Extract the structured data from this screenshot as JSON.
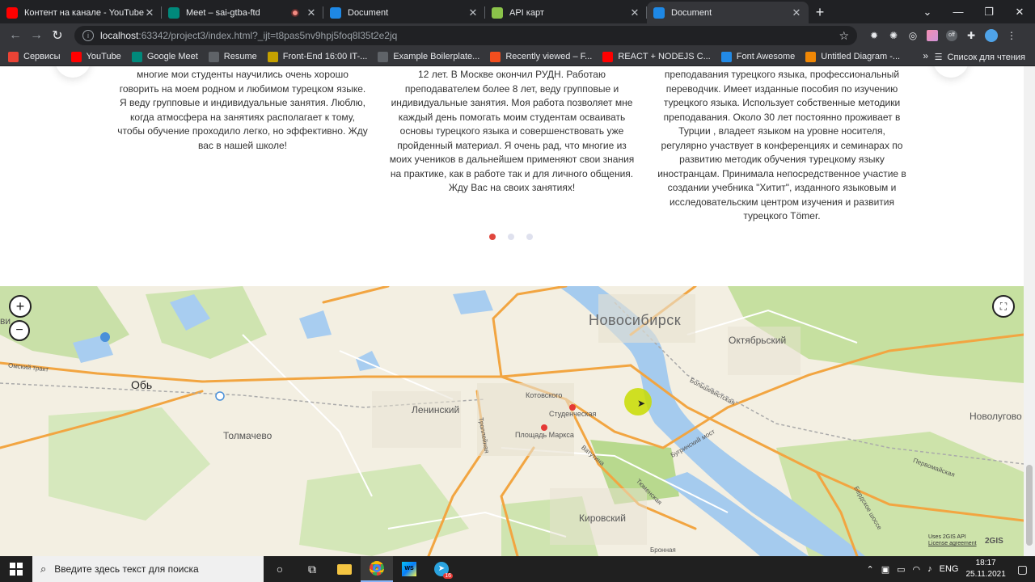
{
  "browser": {
    "tabs": [
      {
        "title": "Контент на канале - YouTube Studio",
        "icon": "youtube-icon",
        "color": "#ff0000",
        "active": false,
        "recording": false
      },
      {
        "title": "Meet – sai-gtba-ftd",
        "icon": "google-meet-icon",
        "color": "#00897b",
        "active": false,
        "recording": true
      },
      {
        "title": "Document",
        "icon": "webstorm-document-icon",
        "color": "#1e88e5",
        "active": false,
        "recording": false
      },
      {
        "title": "API карт",
        "icon": "api-2gis-icon",
        "color": "#8bc34a",
        "active": false,
        "recording": false
      },
      {
        "title": "Document",
        "icon": "webstorm-document-icon",
        "color": "#1e88e5",
        "active": true,
        "recording": false
      }
    ],
    "address": {
      "host": "localhost",
      "path": ":63342/project3/index.html?_ijt=t8pas5nv9hpj5foq8l35t2e2jq"
    },
    "bookmarks": [
      {
        "label": "Сервисы",
        "icon": "apps-grid-icon",
        "color": "#ea4335"
      },
      {
        "label": "YouTube",
        "icon": "youtube-icon",
        "color": "#ff0000"
      },
      {
        "label": "Google Meet",
        "icon": "google-meet-icon",
        "color": "#00897b"
      },
      {
        "label": "Resume",
        "icon": "globe-icon",
        "color": "#5f6368"
      },
      {
        "label": "Front-End 16:00 IT-...",
        "icon": "folder-image-icon",
        "color": "#c5a100"
      },
      {
        "label": "Example Boilerplate...",
        "icon": "globe-icon",
        "color": "#5f6368"
      },
      {
        "label": "Recently viewed – F...",
        "icon": "figma-icon",
        "color": "#f24e1e"
      },
      {
        "label": "REACT + NODEJS C...",
        "icon": "youtube-icon",
        "color": "#ff0000"
      },
      {
        "label": "Font Awesome",
        "icon": "flag-icon",
        "color": "#228ae6"
      },
      {
        "label": "Untitled Diagram -...",
        "icon": "drawio-icon",
        "color": "#f08705"
      }
    ],
    "reading_list": "Список для чтения",
    "more": "»"
  },
  "teachers": {
    "texts": [
      "многие мои студенты научились очень хорошо говорить на моем родном и любимом турецком языке. Я веду групповые и индивидуальные занятия. Люблю, когда атмосфера на занятиях располагает к тому, чтобы обучение проходило легко, но эффективно. Жду вас в нашей школе!",
      "12 лет. В Москве окончил РУДН. Работаю преподавателем более 8 лет, веду групповые и индивидуальные занятия. Моя работа позволяет мне каждый день помогать моим студентам осваивать основы турецкого языка и совершенствовать уже пройденный материал. Я очень рад, что многие из моих учеников в дальнейшем применяют свои знания на практике, как в работе так и для личного общения. Жду Вас на своих занятиях!",
      "преподавания турецкого языка, профессиональный переводчик. Имеет изданные пособия по изучению турецкого языка. Использует собственные методики преподавания. Около 30 лет постоянно проживает в Турции , владеет языком на уровне носителя, регулярно участвует в конференциях и семинарах по развитию методик обучения турецкому языку иностранцам. Принимала непосредственное участие в создании учебника \"Хитит\", изданного языковым и исследовательским центром изучения и развития турецкого Tömer."
    ],
    "slider_active_index": 0,
    "slider_count": 3
  },
  "map": {
    "zoom_in": "+",
    "zoom_out": "−",
    "fullscreen_icon": "fullscreen-icon",
    "labels": {
      "novosibirsk": "Новосибирск",
      "ob": "Обь",
      "oktyabrsky": "Октябрьский",
      "leninsky": "Ленинский",
      "tolmachevo": "Толмачево",
      "kirovsky": "Кировский",
      "novolugovoe": "Новолугово",
      "kotovskogo": "Котовского",
      "studencheskaya": "Студенческая",
      "ploshchad_marksa": "Площадь Маркса",
      "omsky_trakt": "Омский тракт",
      "bolshevistskaya": "Большевистская",
      "bugrinsky_most": "Бугринский мост",
      "vatutina": "Ватутина",
      "tyumenskaya": "Тюменская",
      "pervomayskaya": "Первомайская",
      "berdskoe_shosse": "Бердское шоссе",
      "troleynaya": "Троллейная",
      "bronnaya": "Бронная",
      "left_edge": "ви"
    },
    "attribution": {
      "line1": "Uses 2GIS API",
      "line2": "License agreement",
      "logo": "2GIS"
    }
  },
  "taskbar": {
    "search_placeholder": "Введите здесь текст для поиска",
    "lang": "ENG",
    "time": "18:17",
    "date": "25.11.2021",
    "telegram_badge": "16"
  }
}
